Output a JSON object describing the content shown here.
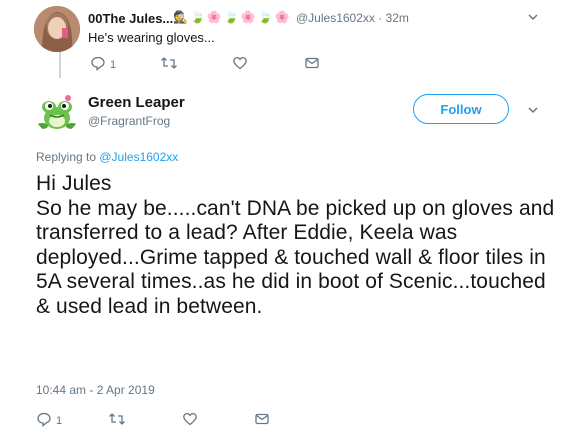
{
  "parent_tweet": {
    "name": "00The Jules...",
    "emoji_badges": [
      "🕵",
      "🍃",
      "🌸",
      "🍃",
      "🌸",
      "🍃",
      "🌸"
    ],
    "handle_time": "@Jules1602xx · 32m",
    "text": "He's wearing gloves...",
    "reply_count": "1",
    "icons": {
      "reply": "reply-icon",
      "retweet": "retweet-icon",
      "like": "heart-icon",
      "dm": "envelope-icon",
      "menu": "chevron-down-icon"
    }
  },
  "main_tweet": {
    "name": "Green Leaper",
    "handle": "@FragrantFrog",
    "follow_label": "Follow",
    "replying_prefix": "Replying to ",
    "replying_to": "@Jules1602xx",
    "text": "Hi Jules\nSo he may be.....can't DNA be picked up on gloves and transferred to a lead? After Eddie, Keela was deployed...Grime tapped & touched wall & floor tiles in 5A several times..as he did in boot of Scenic...touched & used lead in between.",
    "timestamp": "10:44 am - 2 Apr 2019",
    "reply_count": "1"
  },
  "colors": {
    "accent": "#1da1f2",
    "secondary_text": "#657786",
    "primary_text": "#14171a",
    "thread_line": "#ccd6dd"
  }
}
